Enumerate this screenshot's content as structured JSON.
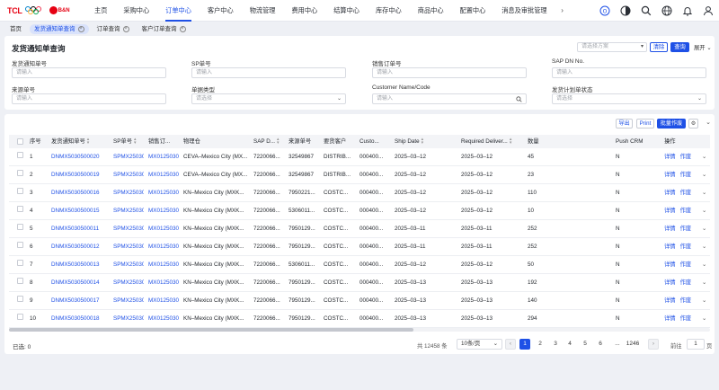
{
  "brand": {
    "logo_text": "TCL",
    "badge_text": "B&N"
  },
  "topnav": {
    "menu": [
      "主页",
      "采购中心",
      "订单中心",
      "客户中心",
      "物流管理",
      "费用中心",
      "结算中心",
      "库存中心",
      "商品中心",
      "配置中心",
      "消息及审批管理"
    ],
    "active_index": 2,
    "more_icon": "chevron-right-icon",
    "right_icons": [
      "olympic-icon",
      "dark-mode-icon",
      "search-icon",
      "globe-icon",
      "bell-icon",
      "user-icon"
    ]
  },
  "tabs": [
    {
      "label": "首页",
      "closable": false,
      "active": false
    },
    {
      "label": "发货通知单查询",
      "closable": true,
      "active": true
    },
    {
      "label": "订单查询",
      "closable": true,
      "active": false
    },
    {
      "label": "客户订单查询",
      "closable": true,
      "active": false
    }
  ],
  "filter": {
    "title": "发货通知单查询",
    "scheme_placeholder": "请选择方案",
    "clear_label": "清除",
    "query_label": "查询",
    "expand_label": "展开",
    "fields": [
      {
        "label": "发货通知单号",
        "placeholder": "请输入",
        "type": "input"
      },
      {
        "label": "SP单号",
        "placeholder": "请输入",
        "type": "input"
      },
      {
        "label": "销售订单号",
        "placeholder": "请输入",
        "type": "input"
      },
      {
        "label": "SAP DN No.",
        "placeholder": "请输入",
        "type": "input"
      },
      {
        "label": "来源单号",
        "placeholder": "请输入",
        "type": "input"
      },
      {
        "label": "单据类型",
        "placeholder": "请选择",
        "type": "select"
      },
      {
        "label": "Customer Name/Code",
        "placeholder": "请输入",
        "type": "search"
      },
      {
        "label": "发货计划单状态",
        "placeholder": "请选择",
        "type": "select"
      }
    ]
  },
  "table_tools": {
    "export_label": "导出",
    "print_label": "Print",
    "batch_void_label": "批量作废"
  },
  "table": {
    "columns": [
      "序号",
      "发货通知单号",
      "SP单号",
      "销售订...",
      "物理仓",
      "SAP D...",
      "来源单号",
      "要货客户",
      "Custo...",
      "Ship Date",
      "Required Deliver...",
      "数量",
      "Push CRM",
      "操作"
    ],
    "rows": [
      {
        "no": "1",
        "dn": "DNMX5030500020",
        "sp": "SPMX25030",
        "so": "MX01250305",
        "wh": "CEVA–Mexico City (MX...",
        "sap": "7220066...",
        "src": "32549867",
        "cust": "DISTRIB...",
        "code": "000400...",
        "ship": "2025–03–12",
        "req": "2025–03–12",
        "qty": "45",
        "crm": "N"
      },
      {
        "no": "2",
        "dn": "DNMX5030500019",
        "sp": "SPMX25030",
        "so": "MX01250305",
        "wh": "CEVA–Mexico City (MX...",
        "sap": "7220066...",
        "src": "32549867",
        "cust": "DISTRIB...",
        "code": "000400...",
        "ship": "2025–03–12",
        "req": "2025–03–12",
        "qty": "23",
        "crm": "N"
      },
      {
        "no": "3",
        "dn": "DNMX5030500016",
        "sp": "SPMX25030",
        "so": "MX01250305",
        "wh": "KN–Mexico City (MXK...",
        "sap": "7220066...",
        "src": "7950221...",
        "cust": "COSTC...",
        "code": "000400...",
        "ship": "2025–03–12",
        "req": "2025–03–12",
        "qty": "110",
        "crm": "N"
      },
      {
        "no": "4",
        "dn": "DNMX5030500015",
        "sp": "SPMX25030",
        "so": "MX01250305",
        "wh": "KN–Mexico City (MXK...",
        "sap": "7220066...",
        "src": "5306011...",
        "cust": "COSTC...",
        "code": "000400...",
        "ship": "2025–03–12",
        "req": "2025–03–12",
        "qty": "10",
        "crm": "N"
      },
      {
        "no": "5",
        "dn": "DNMX5030500011",
        "sp": "SPMX25030",
        "so": "MX01250305",
        "wh": "KN–Mexico City (MXK...",
        "sap": "7220066...",
        "src": "7950129...",
        "cust": "COSTC...",
        "code": "000400...",
        "ship": "2025–03–11",
        "req": "2025–03–11",
        "qty": "252",
        "crm": "N"
      },
      {
        "no": "6",
        "dn": "DNMX5030500012",
        "sp": "SPMX25030",
        "so": "MX01250305",
        "wh": "KN–Mexico City (MXK...",
        "sap": "7220066...",
        "src": "7950129...",
        "cust": "COSTC...",
        "code": "000400...",
        "ship": "2025–03–11",
        "req": "2025–03–11",
        "qty": "252",
        "crm": "N"
      },
      {
        "no": "7",
        "dn": "DNMX5030500013",
        "sp": "SPMX25030",
        "so": "MX01250305",
        "wh": "KN–Mexico City (MXK...",
        "sap": "7220066...",
        "src": "5306011...",
        "cust": "COSTC...",
        "code": "000400...",
        "ship": "2025–03–12",
        "req": "2025–03–12",
        "qty": "50",
        "crm": "N"
      },
      {
        "no": "8",
        "dn": "DNMX5030500014",
        "sp": "SPMX25030",
        "so": "MX01250305",
        "wh": "KN–Mexico City (MXK...",
        "sap": "7220066...",
        "src": "7950129...",
        "cust": "COSTC...",
        "code": "000400...",
        "ship": "2025–03–13",
        "req": "2025–03–13",
        "qty": "192",
        "crm": "N"
      },
      {
        "no": "9",
        "dn": "DNMX5030500017",
        "sp": "SPMX25030",
        "so": "MX01250305",
        "wh": "KN–Mexico City (MXK...",
        "sap": "7220066...",
        "src": "7950129...",
        "cust": "COSTC...",
        "code": "000400...",
        "ship": "2025–03–13",
        "req": "2025–03–13",
        "qty": "140",
        "crm": "N"
      },
      {
        "no": "10",
        "dn": "DNMX5030500018",
        "sp": "SPMX25030",
        "so": "MX01250305",
        "wh": "KN–Mexico City (MXK...",
        "sap": "7220066...",
        "src": "7950129...",
        "cust": "COSTC...",
        "code": "000400...",
        "ship": "2025–03–13",
        "req": "2025–03–13",
        "qty": "294",
        "crm": "N"
      }
    ],
    "action_detail": "详情",
    "action_void": "作废"
  },
  "footer": {
    "selected": "已选: 0",
    "total": "共 12458 条",
    "page_size": "10条/页",
    "pages": [
      "1",
      "2",
      "3",
      "4",
      "5",
      "6",
      "...",
      "1246"
    ],
    "current_page": "1",
    "goto_label": "前往",
    "goto_value": "1",
    "goto_suffix": "页"
  },
  "colors": {
    "primary": "#1e50e6",
    "brand_red": "#e60012"
  }
}
